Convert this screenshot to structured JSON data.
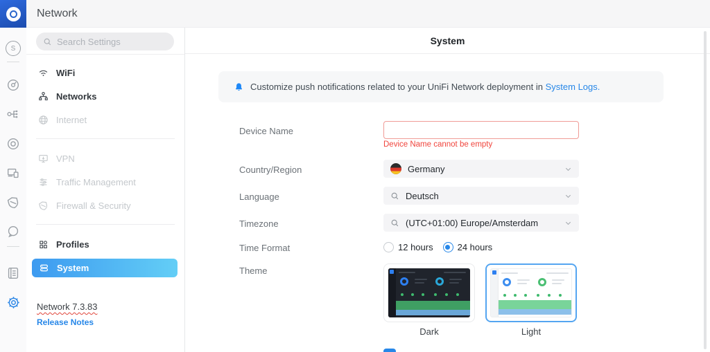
{
  "colors": {
    "accent": "#2787e8",
    "error": "#f0443c",
    "active_start": "#3d9af0",
    "active_end": "#63cef6"
  },
  "topbar": {
    "title": "Network"
  },
  "rail": {
    "site_badge": "S"
  },
  "sidebar": {
    "search_placeholder": "Search Settings",
    "items": [
      {
        "label": "WiFi",
        "enabled": true
      },
      {
        "label": "Networks",
        "enabled": true
      },
      {
        "label": "Internet",
        "enabled": false
      },
      {
        "label": "VPN",
        "enabled": false
      },
      {
        "label": "Traffic Management",
        "enabled": false
      },
      {
        "label": "Firewall & Security",
        "enabled": false
      },
      {
        "label": "Profiles",
        "enabled": true
      },
      {
        "label": "System",
        "enabled": true,
        "active": true
      }
    ],
    "version": "Network 7.3.83",
    "release_notes_label": "Release Notes"
  },
  "content": {
    "header_title": "System",
    "banner": {
      "text": "Customize push notifications related to your UniFi Network deployment in",
      "link_label": "System Logs."
    },
    "form": {
      "device_name": {
        "label": "Device Name",
        "value": "",
        "error": "Device Name cannot be empty"
      },
      "country": {
        "label": "Country/Region",
        "value": "Germany",
        "flag": "germany"
      },
      "language": {
        "label": "Language",
        "value": "Deutsch"
      },
      "timezone": {
        "label": "Timezone",
        "value": "(UTC+01:00) Europe/Amsterdam"
      },
      "time_format": {
        "label": "Time Format",
        "options": [
          {
            "label": "12 hours",
            "selected": false
          },
          {
            "label": "24 hours",
            "selected": true
          }
        ]
      },
      "theme": {
        "label": "Theme",
        "options": [
          {
            "label": "Dark",
            "selected": false
          },
          {
            "label": "Light",
            "selected": true
          }
        ]
      }
    }
  }
}
